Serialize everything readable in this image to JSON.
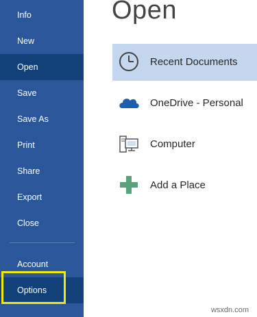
{
  "sidebar": {
    "items": [
      {
        "label": "Info"
      },
      {
        "label": "New"
      },
      {
        "label": "Open"
      },
      {
        "label": "Save"
      },
      {
        "label": "Save As"
      },
      {
        "label": "Print"
      },
      {
        "label": "Share"
      },
      {
        "label": "Export"
      },
      {
        "label": "Close"
      },
      {
        "label": "Account"
      },
      {
        "label": "Options"
      }
    ]
  },
  "main": {
    "title": "Open",
    "places": [
      {
        "label": "Recent Documents",
        "icon": "clock-icon"
      },
      {
        "label": "OneDrive - Personal",
        "icon": "cloud-icon"
      },
      {
        "label": "Computer",
        "icon": "computer-icon"
      },
      {
        "label": "Add a Place",
        "icon": "plus-icon"
      }
    ]
  },
  "watermark": "wsxdn.com",
  "colors": {
    "sidebar_bg": "#2b579a",
    "sidebar_active": "#124078",
    "place_active": "#c5d6ef",
    "highlight_box": "#f1ea00",
    "plus_green": "#5aa17d"
  }
}
